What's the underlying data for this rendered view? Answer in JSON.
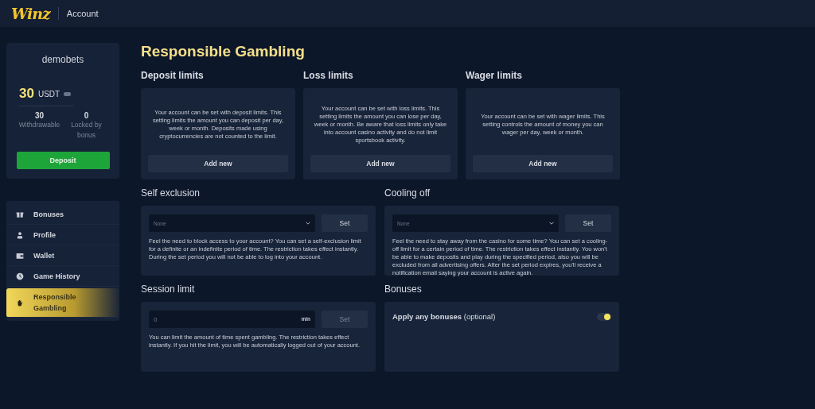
{
  "header": {
    "logo": "Winz",
    "section": "Account"
  },
  "account": {
    "username": "demobets",
    "balance": "30",
    "currency": "USDT",
    "stats": [
      {
        "value": "30",
        "label": "Withdrawable"
      },
      {
        "value": "0",
        "label": "Locked by bonus"
      }
    ],
    "deposit_button": "Deposit"
  },
  "sidebar": {
    "items": [
      {
        "label": "Bonuses",
        "selected": false
      },
      {
        "label": "Profile",
        "selected": false
      },
      {
        "label": "Wallet",
        "selected": false
      },
      {
        "label": "Game History",
        "selected": false
      },
      {
        "label": "Responsible Gambling",
        "selected": true
      }
    ]
  },
  "page_title": "Responsible Gambling",
  "limits": [
    {
      "title": "Deposit limits",
      "text": "Your account can be set with deposit limits. This setting limits the amount you can deposit per day, week or month. Deposits made using cryptocurrencies are not counted to the limit.",
      "button": "Add new"
    },
    {
      "title": "Loss limits",
      "text": "Your account can be set with loss limits. This setting limits the amount you can lose per day, week or month. Be aware that loss limits only take into account casino activity and do not limit sportsbook activity.",
      "button": "Add new"
    },
    {
      "title": "Wager limits",
      "text": "Your account can be set with wager limits. This setting controls the amount of money you can wager per day, week or month.",
      "button": "Add new"
    }
  ],
  "panels": [
    {
      "kind": "select",
      "title": "Self exclusion",
      "value": "None",
      "button": "Set",
      "text": "Feel the need to block access to your account? You can set a self-exclusion limit for a definite or an indefinite period of time. The restriction takes effect instantly. During the set period you will not be able to log into your account."
    },
    {
      "kind": "select",
      "title": "Cooling off",
      "value": "None",
      "button": "Set",
      "text": "Feel the need to stay away from the casino for some time? You can set a cooling-off limit for a certain period of time. The restriction takes effect instantly. You won't be able to make deposits and play during the specified period, also you will be excluded from all advertising offers. After the set period expires, you'll receive a notification email saying your account is active again."
    },
    {
      "kind": "input",
      "title": "Session limit",
      "placeholder": "0",
      "unit": "min",
      "button": "Set",
      "text": "You can limit the amount of time spent gambling. The restriction takes effect instantly. If you hit the limit, you will be automatically logged out of your account."
    },
    {
      "kind": "toggle",
      "title": "Bonuses",
      "label": "**Apply any bonuses** (optional)",
      "on": true
    }
  ]
}
